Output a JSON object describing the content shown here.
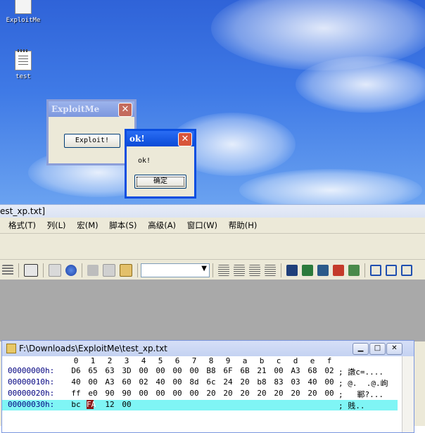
{
  "desktop": {
    "icons": [
      {
        "label": "ExploitMe"
      },
      {
        "label": "test"
      }
    ]
  },
  "exploit_dialog": {
    "title": "ExploitMe",
    "close": "✕",
    "button_label": "Exploit!"
  },
  "ok_dialog": {
    "title": "ok!",
    "close": "✕",
    "message": "ok!",
    "button_label": "确定"
  },
  "editor": {
    "title": "est_xp.txt]",
    "menu": [
      "格式(T)",
      "列(L)",
      "宏(M)",
      "脚本(S)",
      "高级(A)",
      "窗口(W)",
      "帮助(H)"
    ],
    "hex_window": {
      "title": "F:\\Downloads\\ExploitMe\\test_xp.txt",
      "column_header": [
        "0",
        "1",
        "2",
        "3",
        "4",
        "5",
        "6",
        "7",
        "8",
        "9",
        "a",
        "b",
        "c",
        "d",
        "e",
        "f"
      ],
      "rows": [
        {
          "address": "00000000h:",
          "bytes": [
            "D6",
            "65",
            "63",
            "3D",
            "00",
            "00",
            "00",
            "00",
            "B8",
            "6F",
            "6B",
            "21",
            "00",
            "A3",
            "68",
            "02"
          ],
          "ascii": "; 譈c=...."
        },
        {
          "address": "00000010h:",
          "bytes": [
            "40",
            "00",
            "A3",
            "60",
            "02",
            "40",
            "00",
            "8d",
            "6c",
            "24",
            "20",
            "b8",
            "83",
            "03",
            "40",
            "00"
          ],
          "ascii": "; @.  .@.岣"
        },
        {
          "address": "00000020h:",
          "bytes": [
            "ff",
            "e0",
            "90",
            "90",
            "00",
            "00",
            "00",
            "00",
            "20",
            "20",
            "20",
            "20",
            "20",
            "20",
            "20",
            "00"
          ],
          "ascii": ";   鄆?..."
        },
        {
          "address": "00000030h:",
          "bytes": [
            "bc",
            "FA",
            "12",
            "00"
          ],
          "ascii": "; 贱..",
          "highlighted": true
        }
      ]
    }
  },
  "colors": {
    "desktop_top": "#2f63d8",
    "title_active": "#0a4ee0",
    "highlight_row": "#7ff5f5",
    "hex_address": "#000080"
  }
}
